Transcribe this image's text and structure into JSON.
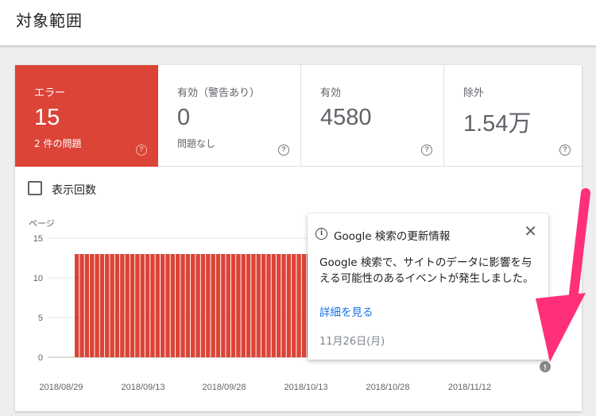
{
  "header": {
    "title": "対象範囲"
  },
  "stats": [
    {
      "label": "エラー",
      "value": "15",
      "sub": "2 件の問題",
      "active": true
    },
    {
      "label": "有効（警告あり）",
      "value": "0",
      "sub": "問題なし",
      "active": false
    },
    {
      "label": "有効",
      "value": "4580",
      "sub": "",
      "active": false
    },
    {
      "label": "除外",
      "value": "1.54万",
      "sub": "",
      "active": false
    }
  ],
  "impressions_checkbox": {
    "label": "表示回数",
    "checked": false
  },
  "colors": {
    "error": "#db4437",
    "error_faded": "#f7d7d4",
    "link": "#1a73e8",
    "annotation_arrow": "#ff2f7a"
  },
  "chart_data": {
    "type": "bar",
    "ylabel": "ページ",
    "ylim": [
      0,
      15
    ],
    "yticks": [
      0,
      5,
      10,
      15
    ],
    "x_tick_labels": [
      "2018/08/29",
      "2018/09/13",
      "2018/09/28",
      "2018/10/13",
      "2018/10/28",
      "2018/11/12"
    ],
    "series": [
      {
        "values": [
          13,
          13,
          13,
          13,
          13,
          13,
          13,
          13,
          13,
          13,
          13,
          13,
          13,
          13,
          13,
          13,
          13,
          13,
          13,
          13,
          13,
          13,
          13,
          13,
          13,
          13,
          13,
          13,
          13,
          13,
          13,
          13,
          13,
          13,
          13,
          13,
          13,
          13,
          13,
          13,
          13,
          13,
          13,
          13,
          13,
          13,
          13,
          13,
          13,
          13,
          13,
          13,
          13,
          13,
          13,
          13,
          13,
          13,
          13,
          13,
          13,
          13,
          13,
          13,
          13,
          13,
          13,
          13,
          13,
          13,
          13,
          13,
          13,
          13,
          13,
          13,
          13,
          13,
          13,
          13,
          13,
          13,
          13,
          13,
          15,
          15,
          15,
          15,
          15,
          15,
          15,
          15,
          15,
          15
        ]
      }
    ],
    "annotation_marker_icon": "info-icon"
  },
  "tooltip": {
    "icon": "info-icon",
    "title": "Google 検索の更新情報",
    "body": "Google 検索で、サイトのデータに影響を与える可能性のあるイベントが発生しました。",
    "link": "詳細を見る",
    "date": "11月26日(月)"
  }
}
